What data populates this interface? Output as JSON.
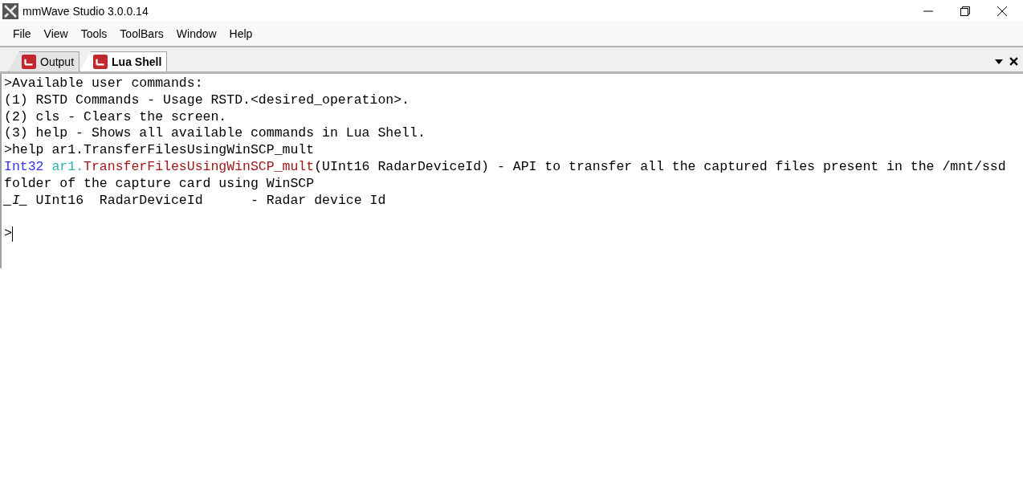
{
  "window": {
    "title": "mmWave Studio 3.0.0.14"
  },
  "menu": [
    "File",
    "View",
    "Tools",
    "ToolBars",
    "Window",
    "Help"
  ],
  "tabs": [
    {
      "label": "Output",
      "selected": false
    },
    {
      "label": "Lua Shell",
      "selected": true
    }
  ],
  "console": {
    "lines": [
      {
        "segments": [
          {
            "text": ">Available user commands:",
            "color": "#000000"
          }
        ]
      },
      {
        "segments": [
          {
            "text": "(1) RSTD Commands - Usage RSTD.<desired_operation>.",
            "color": "#000000"
          }
        ]
      },
      {
        "segments": [
          {
            "text": "(2) cls - Clears the screen.",
            "color": "#000000"
          }
        ]
      },
      {
        "segments": [
          {
            "text": "(3) help - Shows all available commands in Lua Shell.",
            "color": "#000000"
          }
        ]
      },
      {
        "segments": [
          {
            "text": ">help ar1.TransferFilesUsingWinSCP_mult",
            "color": "#000000"
          }
        ]
      },
      {
        "segments": [
          {
            "text": "Int32 ",
            "color": "#3333ff"
          },
          {
            "text": "ar1.",
            "color": "#2ab0b0"
          },
          {
            "text": "TransferFilesUsingWinSCP_mult",
            "color": "#a01818"
          },
          {
            "text": "(UInt16 RadarDeviceId) - API to transfer all the captured files present in the /mnt/ssd",
            "color": "#000000"
          }
        ]
      },
      {
        "segments": [
          {
            "text": "folder of the capture card using WinSCP",
            "color": "#000000"
          }
        ]
      },
      {
        "segments": [
          {
            "text": "_I_",
            "color": "#000000",
            "italic": true
          },
          {
            "text": " UInt16  RadarDeviceId      - Radar device Id",
            "color": "#000000"
          }
        ]
      }
    ],
    "prompt": ">"
  }
}
